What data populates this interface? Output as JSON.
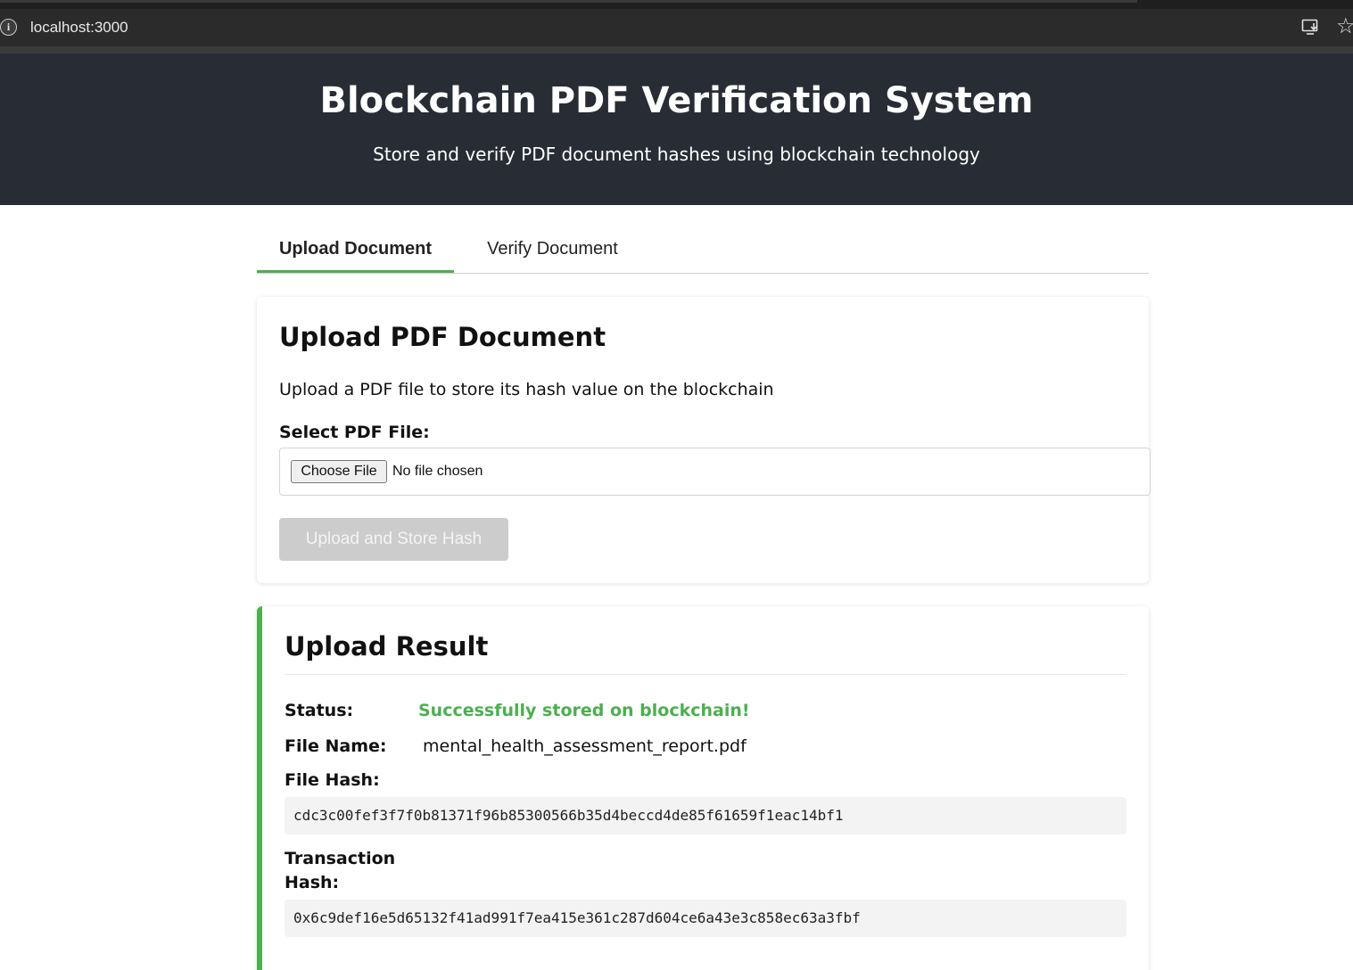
{
  "browser": {
    "url": "localhost:3000",
    "icons": [
      "info-icon",
      "install-app-icon",
      "bookmark-star-icon"
    ]
  },
  "header": {
    "title": "Blockchain PDF Verification System",
    "subtitle": "Store and verify PDF document hashes using blockchain technology"
  },
  "tabs": [
    {
      "label": "Upload Document",
      "active": true
    },
    {
      "label": "Verify Document",
      "active": false
    }
  ],
  "upload": {
    "title": "Upload PDF Document",
    "description": "Upload a PDF file to store its hash value on the blockchain",
    "field_label": "Select PDF File:",
    "choose_button": "Choose File",
    "file_status": "No file chosen",
    "submit_button": "Upload and Store Hash",
    "submit_disabled": true
  },
  "result": {
    "title": "Upload Result",
    "status_label": "Status:",
    "status_value": "Successfully stored on blockchain!",
    "file_name_label": "File Name:",
    "file_name": "mental_health_assessment_report.pdf",
    "file_hash_label": "File Hash:",
    "file_hash": "cdc3c00fef3f7f0b81371f96b85300566b35d4beccd4de85f61659f1eac14bf1",
    "tx_hash_label_line1": "Transaction",
    "tx_hash_label_line2": "Hash:",
    "tx_hash": "0x6c9def16e5d65132f41ad991f7ea415e361c287d604ce6a43e3c858ec63a3fbf"
  },
  "colors": {
    "header_bg": "#282c34",
    "accent": "#4caf50",
    "disabled_button": "#cccccc"
  }
}
